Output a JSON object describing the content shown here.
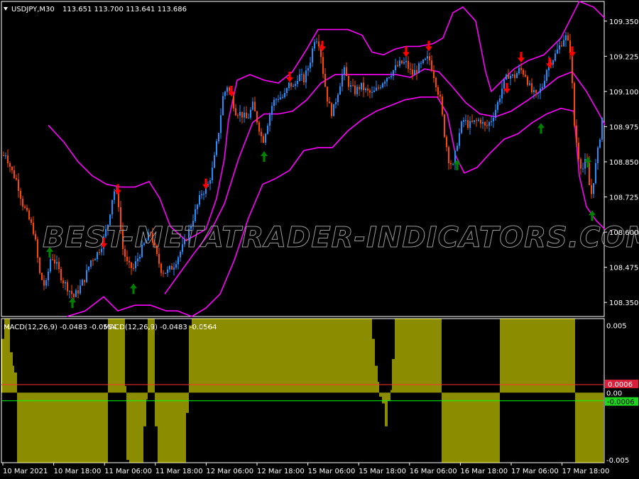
{
  "chart_data": {
    "type": "candlestick",
    "header": {
      "symbol": "USDJPY,M30",
      "values": "113.651 113.700 113.641 113.686"
    },
    "watermark": "BEST-METATRADER-INDICATORS.COM",
    "price_axis": {
      "ticks": [
        "109.350",
        "109.225",
        "109.100",
        "108.975",
        "108.850",
        "108.725",
        "108.600",
        "108.475",
        "108.350"
      ],
      "tick_values": [
        109.35,
        109.225,
        109.1,
        108.975,
        108.85,
        108.725,
        108.6,
        108.475,
        108.35
      ],
      "range": [
        108.3,
        109.42
      ]
    },
    "time_axis": {
      "labels": [
        "10 Mar 2021",
        "10 Mar 18:00",
        "11 Mar 06:00",
        "11 Mar 18:00",
        "12 Mar 06:00",
        "12 Mar 18:00",
        "15 Mar 06:00",
        "15 Mar 18:00",
        "16 Mar 06:00",
        "16 Mar 18:00",
        "17 Mar 06:00",
        "17 Mar 18:00"
      ]
    },
    "price_path": [
      [
        0,
        108.86
      ],
      [
        8,
        108.88
      ],
      [
        16,
        108.82
      ],
      [
        24,
        108.78
      ],
      [
        32,
        108.7
      ],
      [
        40,
        108.65
      ],
      [
        48,
        108.6
      ],
      [
        56,
        108.45
      ],
      [
        64,
        108.4
      ],
      [
        72,
        108.52
      ],
      [
        80,
        108.48
      ],
      [
        88,
        108.43
      ],
      [
        96,
        108.4
      ],
      [
        104,
        108.37
      ],
      [
        112,
        108.4
      ],
      [
        120,
        108.44
      ],
      [
        128,
        108.5
      ],
      [
        136,
        108.52
      ],
      [
        144,
        108.56
      ],
      [
        152,
        108.63
      ],
      [
        160,
        108.75
      ],
      [
        166,
        108.73
      ],
      [
        172,
        108.55
      ],
      [
        180,
        108.48
      ],
      [
        188,
        108.47
      ],
      [
        196,
        108.52
      ],
      [
        204,
        108.56
      ],
      [
        212,
        108.6
      ],
      [
        220,
        108.52
      ],
      [
        228,
        108.46
      ],
      [
        236,
        108.46
      ],
      [
        244,
        108.48
      ],
      [
        252,
        108.52
      ],
      [
        260,
        108.56
      ],
      [
        268,
        108.62
      ],
      [
        276,
        108.68
      ],
      [
        284,
        108.74
      ],
      [
        292,
        108.76
      ],
      [
        300,
        108.83
      ],
      [
        308,
        108.96
      ],
      [
        314,
        109.08
      ],
      [
        320,
        109.12
      ],
      [
        326,
        109.08
      ],
      [
        332,
        109.03
      ],
      [
        340,
        109.02
      ],
      [
        348,
        109.0
      ],
      [
        356,
        109.05
      ],
      [
        364,
        108.98
      ],
      [
        370,
        108.92
      ],
      [
        376,
        108.98
      ],
      [
        384,
        109.06
      ],
      [
        392,
        109.08
      ],
      [
        400,
        109.08
      ],
      [
        408,
        109.13
      ],
      [
        414,
        109.11
      ],
      [
        420,
        109.16
      ],
      [
        428,
        109.14
      ],
      [
        436,
        109.2
      ],
      [
        444,
        109.3
      ],
      [
        450,
        109.27
      ],
      [
        456,
        109.15
      ],
      [
        462,
        109.06
      ],
      [
        468,
        109.02
      ],
      [
        476,
        109.1
      ],
      [
        484,
        109.18
      ],
      [
        492,
        109.12
      ],
      [
        500,
        109.1
      ],
      [
        508,
        109.12
      ],
      [
        516,
        109.1
      ],
      [
        524,
        109.09
      ],
      [
        532,
        109.11
      ],
      [
        540,
        109.14
      ],
      [
        548,
        109.16
      ],
      [
        556,
        109.18
      ],
      [
        564,
        109.2
      ],
      [
        572,
        109.2
      ],
      [
        580,
        109.16
      ],
      [
        588,
        109.18
      ],
      [
        596,
        109.2
      ],
      [
        604,
        109.22
      ],
      [
        612,
        109.15
      ],
      [
        620,
        109.07
      ],
      [
        626,
        108.95
      ],
      [
        632,
        108.86
      ],
      [
        638,
        108.83
      ],
      [
        644,
        108.92
      ],
      [
        652,
        109.0
      ],
      [
        660,
        108.98
      ],
      [
        668,
        108.99
      ],
      [
        676,
        109.0
      ],
      [
        684,
        108.97
      ],
      [
        692,
        109.0
      ],
      [
        700,
        109.05
      ],
      [
        708,
        109.12
      ],
      [
        716,
        109.16
      ],
      [
        724,
        109.15
      ],
      [
        732,
        109.18
      ],
      [
        740,
        109.16
      ],
      [
        748,
        109.1
      ],
      [
        756,
        109.08
      ],
      [
        764,
        109.12
      ],
      [
        772,
        109.2
      ],
      [
        780,
        109.22
      ],
      [
        788,
        109.26
      ],
      [
        796,
        109.3
      ],
      [
        804,
        109.24
      ],
      [
        808,
        109.0
      ],
      [
        814,
        108.88
      ],
      [
        820,
        108.82
      ],
      [
        826,
        108.86
      ],
      [
        832,
        108.72
      ],
      [
        838,
        108.82
      ],
      [
        844,
        108.92
      ],
      [
        850,
        109.05
      ]
    ],
    "bollinger": {
      "upper": [
        [
          68,
          108.98
        ],
        [
          90,
          108.92
        ],
        [
          110,
          108.85
        ],
        [
          130,
          108.8
        ],
        [
          150,
          108.77
        ],
        [
          170,
          108.76
        ],
        [
          190,
          108.76
        ],
        [
          210,
          108.78
        ],
        [
          225,
          108.72
        ],
        [
          240,
          108.62
        ],
        [
          262,
          108.57
        ],
        [
          290,
          108.61
        ],
        [
          305,
          108.72
        ],
        [
          316,
          108.86
        ],
        [
          322,
          109.0
        ],
        [
          334,
          109.14
        ],
        [
          352,
          109.16
        ],
        [
          372,
          109.14
        ],
        [
          392,
          109.13
        ],
        [
          412,
          109.17
        ],
        [
          432,
          109.25
        ],
        [
          448,
          109.32
        ],
        [
          468,
          109.32
        ],
        [
          490,
          109.32
        ],
        [
          510,
          109.3
        ],
        [
          524,
          109.24
        ],
        [
          540,
          109.23
        ],
        [
          556,
          109.25
        ],
        [
          572,
          109.26
        ],
        [
          590,
          109.26
        ],
        [
          610,
          109.27
        ],
        [
          624,
          109.29
        ],
        [
          638,
          109.38
        ],
        [
          652,
          109.4
        ],
        [
          670,
          109.35
        ],
        [
          684,
          109.17
        ],
        [
          692,
          109.1
        ],
        [
          704,
          109.13
        ],
        [
          724,
          109.18
        ],
        [
          744,
          109.21
        ],
        [
          766,
          109.23
        ],
        [
          790,
          109.29
        ],
        [
          804,
          109.36
        ],
        [
          816,
          109.42
        ],
        [
          836,
          109.4
        ],
        [
          852,
          109.36
        ]
      ],
      "middle": [
        [
          232,
          108.38
        ],
        [
          252,
          108.45
        ],
        [
          272,
          108.52
        ],
        [
          296,
          108.6
        ],
        [
          316,
          108.7
        ],
        [
          336,
          108.86
        ],
        [
          356,
          108.99
        ],
        [
          372,
          109.02
        ],
        [
          392,
          109.02
        ],
        [
          412,
          109.03
        ],
        [
          432,
          109.07
        ],
        [
          452,
          109.13
        ],
        [
          472,
          109.16
        ],
        [
          494,
          109.16
        ],
        [
          516,
          109.16
        ],
        [
          536,
          109.16
        ],
        [
          558,
          109.16
        ],
        [
          578,
          109.15
        ],
        [
          598,
          109.18
        ],
        [
          618,
          109.17
        ],
        [
          636,
          109.12
        ],
        [
          656,
          109.06
        ],
        [
          676,
          109.02
        ],
        [
          698,
          109.01
        ],
        [
          720,
          109.03
        ],
        [
          744,
          109.07
        ],
        [
          766,
          109.11
        ],
        [
          786,
          109.15
        ],
        [
          806,
          109.17
        ],
        [
          826,
          109.1
        ],
        [
          844,
          109.02
        ],
        [
          852,
          108.98
        ]
      ],
      "lower": [
        [
          94,
          108.3
        ],
        [
          120,
          108.32
        ],
        [
          146,
          108.37
        ],
        [
          166,
          108.32
        ],
        [
          190,
          108.34
        ],
        [
          212,
          108.34
        ],
        [
          234,
          108.32
        ],
        [
          250,
          108.32
        ],
        [
          270,
          108.3
        ],
        [
          290,
          108.33
        ],
        [
          310,
          108.38
        ],
        [
          330,
          108.5
        ],
        [
          350,
          108.65
        ],
        [
          370,
          108.77
        ],
        [
          388,
          108.79
        ],
        [
          408,
          108.82
        ],
        [
          428,
          108.89
        ],
        [
          448,
          108.9
        ],
        [
          468,
          108.9
        ],
        [
          490,
          108.96
        ],
        [
          510,
          109.0
        ],
        [
          530,
          109.03
        ],
        [
          550,
          109.05
        ],
        [
          570,
          109.07
        ],
        [
          592,
          109.08
        ],
        [
          616,
          109.08
        ],
        [
          630,
          109.02
        ],
        [
          642,
          108.87
        ],
        [
          654,
          108.81
        ],
        [
          672,
          108.83
        ],
        [
          690,
          108.88
        ],
        [
          710,
          108.93
        ],
        [
          730,
          108.95
        ],
        [
          750,
          108.99
        ],
        [
          770,
          109.02
        ],
        [
          790,
          109.04
        ],
        [
          808,
          109.03
        ],
        [
          816,
          108.8
        ],
        [
          826,
          108.69
        ],
        [
          840,
          108.64
        ],
        [
          852,
          108.61
        ]
      ]
    },
    "sell_arrows": [
      [
        146,
        108.56
      ],
      [
        166,
        108.75
      ],
      [
        290,
        108.77
      ],
      [
        326,
        109.1
      ],
      [
        408,
        109.15
      ],
      [
        454,
        109.26
      ],
      [
        572,
        109.24
      ],
      [
        604,
        109.26
      ],
      [
        714,
        109.11
      ],
      [
        734,
        109.22
      ],
      [
        774,
        109.2
      ],
      [
        806,
        109.24
      ]
    ],
    "buy_arrows": [
      [
        70,
        108.53
      ],
      [
        102,
        108.35
      ],
      [
        188,
        108.4
      ],
      [
        372,
        108.87
      ],
      [
        644,
        108.84
      ],
      [
        762,
        108.97
      ],
      [
        828,
        108.85
      ],
      [
        834,
        108.66
      ]
    ],
    "macd": {
      "title": "MACD(12,26,9) -0.0483 -0.0564",
      "title_repeat": "MACD(12,26,9) -0.0483 -0.0564",
      "axis_ticks": [
        "0.005",
        "-0.005"
      ],
      "axis_tick_values": [
        0.005,
        -0.005
      ],
      "zero_label": "0.00",
      "upper_level_label": "0.0006",
      "lower_level_label": "-0.0006",
      "upper_level": 0.0006,
      "lower_level": -0.0006,
      "range": [
        -0.0052,
        0.0055
      ],
      "histogram_segments": [
        [
          3,
          0.004
        ],
        [
          6,
          0.0095
        ],
        [
          9,
          0.0095
        ],
        [
          12,
          0.006
        ],
        [
          15,
          0.003
        ],
        [
          18,
          0.002
        ],
        [
          21,
          0.0015
        ],
        [
          24,
          -0.011
        ],
        [
          40,
          -0.011
        ],
        [
          80,
          -0.011
        ],
        [
          120,
          -0.011
        ],
        [
          140,
          -0.011
        ],
        [
          148,
          -0.008
        ],
        [
          152,
          0.0095
        ],
        [
          160,
          0.0095
        ],
        [
          170,
          0.0095
        ],
        [
          176,
          0.0005
        ],
        [
          178,
          -0.005
        ],
        [
          182,
          -0.0065
        ],
        [
          186,
          -0.011
        ],
        [
          196,
          -0.011
        ],
        [
          202,
          -0.0025
        ],
        [
          206,
          -0.0005
        ],
        [
          208,
          0.0095
        ],
        [
          212,
          0.0095
        ],
        [
          216,
          0.0095
        ],
        [
          218,
          -0.0025
        ],
        [
          222,
          -0.011
        ],
        [
          240,
          -0.011
        ],
        [
          262,
          -0.0015
        ],
        [
          266,
          0.005
        ],
        [
          270,
          0.0095
        ],
        [
          300,
          0.0095
        ],
        [
          360,
          0.0095
        ],
        [
          420,
          0.0095
        ],
        [
          474,
          0.0095
        ],
        [
          478,
          0.0065
        ],
        [
          482,
          0.0095
        ],
        [
          520,
          0.0095
        ],
        [
          524,
          0.004
        ],
        [
          528,
          0.002
        ],
        [
          532,
          0.0008
        ],
        [
          534,
          -0.0003
        ],
        [
          538,
          -0.0008
        ],
        [
          542,
          -0.0025
        ],
        [
          546,
          -0.0006
        ],
        [
          550,
          0.0002
        ],
        [
          552,
          0.0025
        ],
        [
          556,
          0.0095
        ],
        [
          600,
          0.0095
        ],
        [
          618,
          0.0095
        ],
        [
          622,
          -0.011
        ],
        [
          650,
          -0.011
        ],
        [
          680,
          -0.011
        ],
        [
          700,
          -0.011
        ],
        [
          704,
          0.0095
        ],
        [
          740,
          0.0095
        ],
        [
          780,
          0.0095
        ],
        [
          806,
          0.0095
        ],
        [
          810,
          -0.011
        ],
        [
          830,
          -0.011
        ],
        [
          850,
          -0.011
        ]
      ]
    }
  },
  "colors": {
    "background": "#000000",
    "grid": "#ffffff",
    "bull_candle": "#1e90ff",
    "bear_candle": "#ff4500",
    "bollinger": "#ff00ff",
    "sell_arrow": "#ff0000",
    "buy_arrow": "#008000",
    "histogram": "#ffff00",
    "upper_level": "#ff3030",
    "lower_level": "#00ff00",
    "upper_level_box": "#d91f3a",
    "lower_level_box": "#1fd41f"
  }
}
